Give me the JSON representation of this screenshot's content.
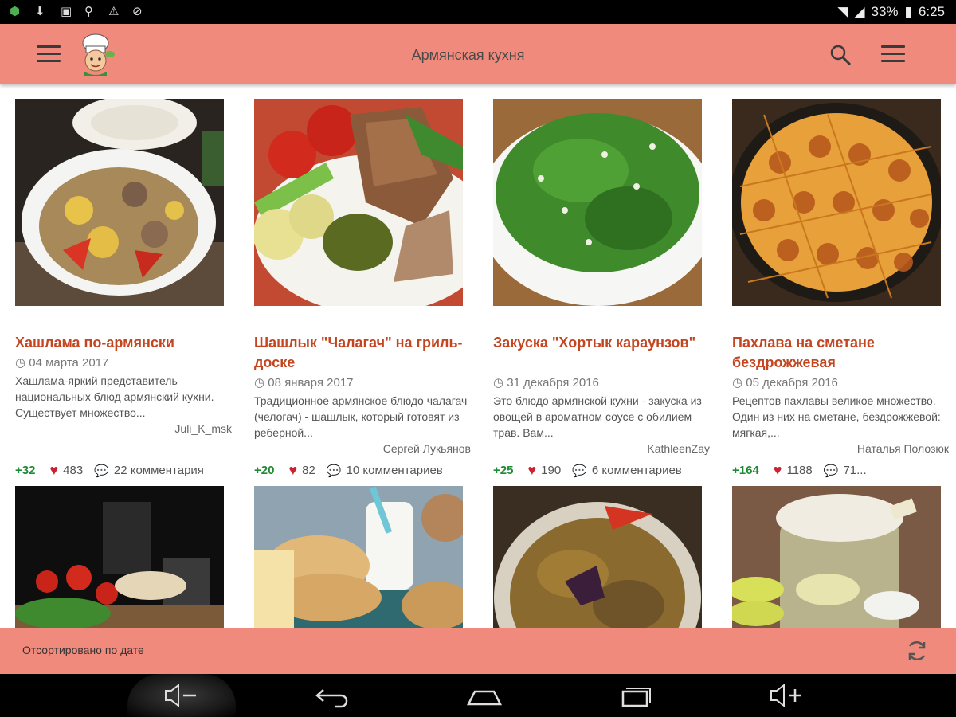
{
  "status_bar": {
    "battery": "33%",
    "time": "6:25"
  },
  "app_bar": {
    "title": "Армянская кухня"
  },
  "recipes": [
    {
      "title": "Хашлама по-армянски",
      "date": "04 марта 2017",
      "desc": "Хашлама-яркий представитель национальных блюд армянский кухни. Существует множество...",
      "author": "Juli_K_msk",
      "score": "+32",
      "likes": "483",
      "comments": "22 комментария"
    },
    {
      "title": "Шашлык \"Чалагач\" на гриль-доске",
      "date": "08 января 2017",
      "desc": "Традиционное армянское блюдо чалагач (челогач) - шашлык, который готовят из реберной...",
      "author": "Сергей Лукьянов",
      "score": "+20",
      "likes": "82",
      "comments": "10 комментариев"
    },
    {
      "title": "Закуска \"Хортык караунзов\"",
      "date": "31 декабря 2016",
      "desc": "Это блюдо армянской кухни - закуска из овощей в ароматном соусе с обилием трав. Вам...",
      "author": "KathleenZay",
      "score": "+25",
      "likes": "190",
      "comments": "6 комментариев"
    },
    {
      "title": "Пахлава на сметане бездрожжевая",
      "date": "05 декабря 2016",
      "desc": "Рецептов пахлавы великое множество. Один из них на сметане, бездрожжевой: мягкая,...",
      "author": "Наталья Полозюк",
      "score": "+164",
      "likes": "1188",
      "comments": "71..."
    }
  ],
  "bottom_bar": {
    "sort_label": "Отсортировано по дате"
  },
  "icons": {
    "menu": "menu-icon",
    "logo": "chef-logo",
    "search": "search-icon",
    "overflow": "overflow-menu-icon",
    "clock": "clock-icon",
    "heart": "heart-icon",
    "comment": "comment-icon",
    "refresh": "refresh-icon",
    "vol_down": "volume-down-icon",
    "back": "back-icon",
    "home": "home-icon",
    "recents": "recents-icon",
    "vol_up": "volume-up-icon"
  },
  "colors": {
    "accent": "#f08a7c",
    "title": "#c4451f",
    "score": "#1e8a33",
    "heart": "#c8232e"
  }
}
